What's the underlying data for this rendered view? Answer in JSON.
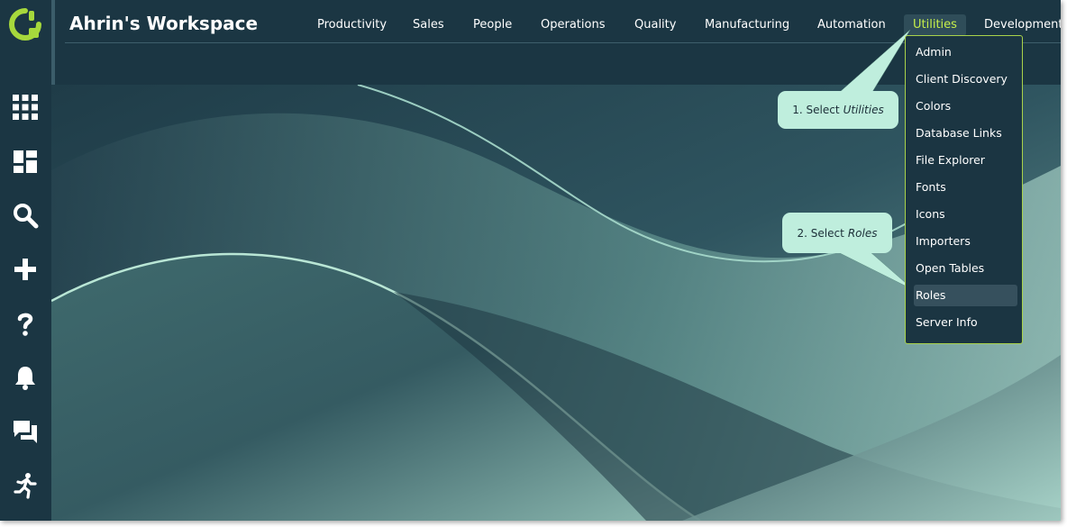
{
  "header": {
    "workspace_title": "Ahrin's Workspace",
    "nav": [
      "Productivity",
      "Sales",
      "People",
      "Operations",
      "Quality",
      "Manufacturing",
      "Automation",
      "Utilities",
      "Development"
    ],
    "active_nav": "Utilities"
  },
  "sidebar": {
    "icons": [
      "apps-grid-icon",
      "dashboard-icon",
      "search-icon",
      "plus-icon",
      "help-icon",
      "bell-icon",
      "chat-icon",
      "running-icon"
    ]
  },
  "utilities_menu": {
    "items": [
      "Admin",
      "Client Discovery",
      "Colors",
      "Database Links",
      "File Explorer",
      "Fonts",
      "Icons",
      "Importers",
      "Open Tables",
      "Roles",
      "Server Info"
    ],
    "highlighted": "Roles"
  },
  "callouts": {
    "step1_prefix": "1. Select",
    "step1_target": "Utilities",
    "step2_prefix": "2. Select",
    "step2_target": "Roles"
  },
  "colors": {
    "accent": "#c6ef4a",
    "header_bg": "#1b3643",
    "callout_bg": "#bfeedd",
    "menu_border": "#a9d24a"
  }
}
